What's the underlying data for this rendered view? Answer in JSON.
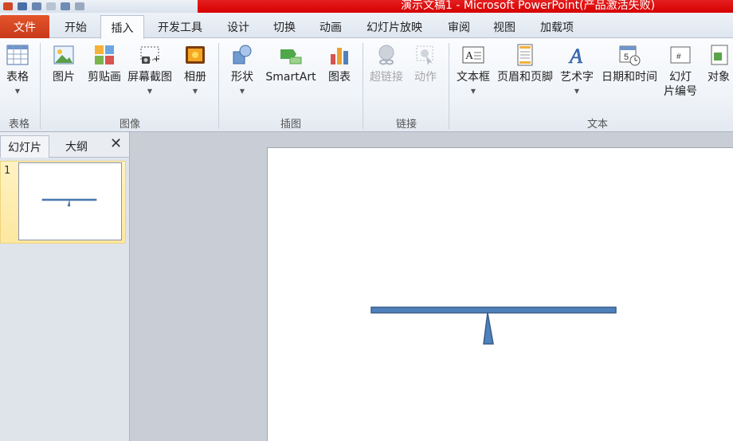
{
  "app": {
    "title": "演示文稿1 - Microsoft PowerPoint(产品激活失败)"
  },
  "tabs": {
    "file": "文件",
    "items": [
      "开始",
      "插入",
      "开发工具",
      "设计",
      "切换",
      "动画",
      "幻灯片放映",
      "审阅",
      "视图",
      "加载项"
    ],
    "active": "插入"
  },
  "ribbon": {
    "table": "表格",
    "picture": "图片",
    "clipart": "剪贴画",
    "screenshot": "屏幕截图",
    "album": "相册",
    "shapes": "形状",
    "smartart": "SmartArt",
    "chart": "图表",
    "hyperlink": "超链接",
    "action": "动作",
    "textbox": "文本框",
    "header_footer": "页眉和页脚",
    "wordart": "艺术字",
    "datetime": "日期和时间",
    "slidenum_line1": "幻灯",
    "slidenum_line2": "片编号",
    "object": "对象",
    "groups": {
      "tables": "表格",
      "images": "图像",
      "illustrations": "插图",
      "links": "链接",
      "text": "文本"
    }
  },
  "panel": {
    "tab_slides": "幻灯片",
    "tab_outline": "大纲",
    "close": "✕",
    "slide_number": "1"
  },
  "colors": {
    "title_bar": "#d70000",
    "file_tab": "#d8461f",
    "shape_fill": "#4f81bd",
    "shape_stroke": "#385d8a",
    "slide_selected": "#fde7a0"
  }
}
